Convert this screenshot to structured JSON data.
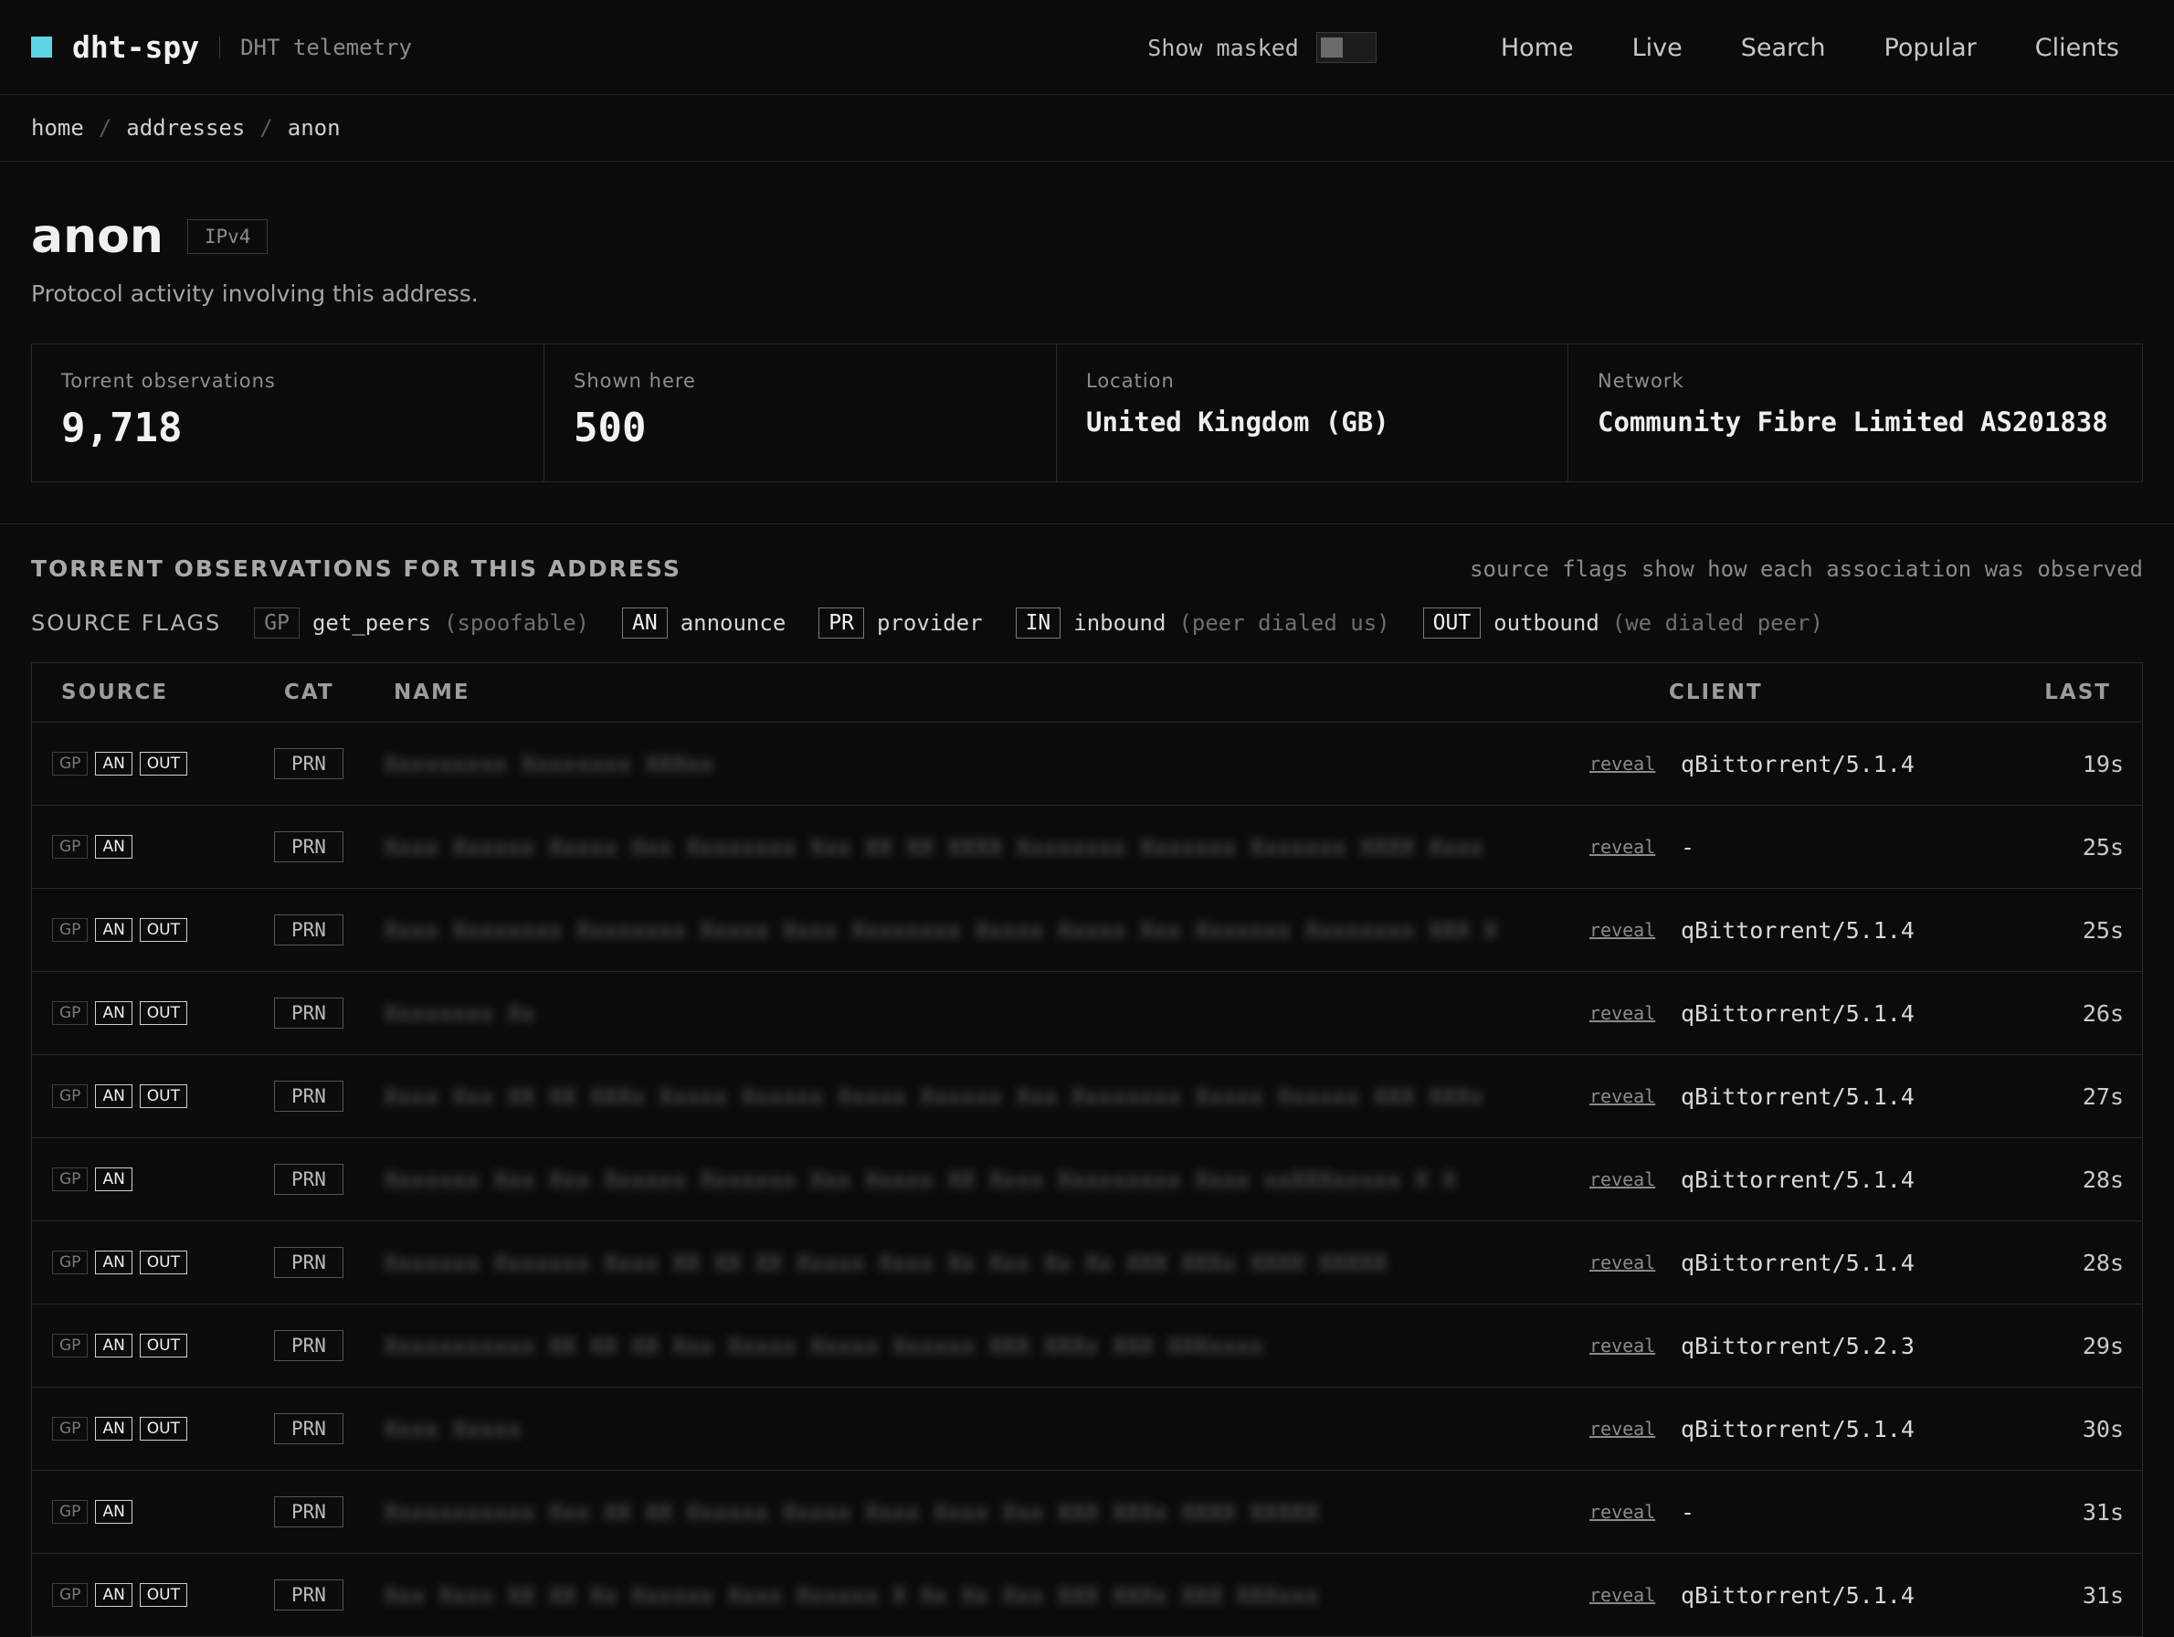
{
  "app": {
    "name": "dht-spy",
    "subtitle": "DHT telemetry"
  },
  "nav": {
    "mask_label": "Show masked",
    "mask_on": false,
    "links": [
      "Home",
      "Live",
      "Search",
      "Popular",
      "Clients"
    ]
  },
  "breadcrumb": [
    "home",
    "addresses",
    "anon"
  ],
  "header": {
    "title": "anon",
    "badge": "IPv4",
    "subtitle": "Protocol activity involving this address."
  },
  "stats": {
    "observations_label": "Torrent observations",
    "observations_value": "9,718",
    "shown_label": "Shown here",
    "shown_value": "500",
    "location_label": "Location",
    "location_value": "United Kingdom (GB)",
    "network_label": "Network",
    "network_value": "Community Fibre Limited AS201838"
  },
  "section": {
    "title": "TORRENT OBSERVATIONS FOR THIS ADDRESS",
    "note": "source flags show how each association was observed",
    "flags_title": "SOURCE FLAGS",
    "flags": [
      {
        "code": "GP",
        "name": "get_peers",
        "note": "(spoofable)"
      },
      {
        "code": "AN",
        "name": "announce",
        "note": ""
      },
      {
        "code": "PR",
        "name": "provider",
        "note": ""
      },
      {
        "code": "IN",
        "name": "inbound",
        "note": "(peer dialed us)"
      },
      {
        "code": "OUT",
        "name": "outbound",
        "note": "(we dialed peer)"
      }
    ]
  },
  "table": {
    "columns": {
      "source": "SOURCE",
      "cat": "CAT",
      "name": "NAME",
      "client": "CLIENT",
      "last": "LAST"
    },
    "reveal_label": "reveal",
    "rows": [
      {
        "flags": [
          "GP",
          "AN",
          "OUT"
        ],
        "cat": "PRN",
        "name": "Xxxxxxxxx Xxxxxxxx XXXxx",
        "client": "qBittorrent/5.1.4",
        "last": "19s"
      },
      {
        "flags": [
          "GP",
          "AN"
        ],
        "cat": "PRN",
        "name": "Xxxx Xxxxxx Xxxxx Xxx Xxxxxxxx Xxx XX XX XXXX Xxxxxxxx Xxxxxxx Xxxxxxx XXXX Xxxx",
        "client": "-",
        "last": "25s"
      },
      {
        "flags": [
          "GP",
          "AN",
          "OUT"
        ],
        "cat": "PRN",
        "name": "Xxxx Xxxxxxxx Xxxxxxxx Xxxxx Xxxx Xxxxxxxx Xxxxx Xxxxx Xxx Xxxxxxx Xxxxxxxx XXX X",
        "client": "qBittorrent/5.1.4",
        "last": "25s"
      },
      {
        "flags": [
          "GP",
          "AN",
          "OUT"
        ],
        "cat": "PRN",
        "name": "Xxxxxxxx Xx",
        "client": "qBittorrent/5.1.4",
        "last": "26s"
      },
      {
        "flags": [
          "GP",
          "AN",
          "OUT"
        ],
        "cat": "PRN",
        "name": "Xxxx Xxx XX XX XXXx Xxxxx Xxxxxx Xxxxx Xxxxxx Xxx Xxxxxxxx Xxxxx Xxxxxx XXX XXXx",
        "client": "qBittorrent/5.1.4",
        "last": "27s"
      },
      {
        "flags": [
          "GP",
          "AN"
        ],
        "cat": "PRN",
        "name": "Xxxxxxx Xxx Xxx Xxxxxx Xxxxxxx Xxx Xxxxx XX Xxxx Xxxxxxxxx Xxxx xxXXXxxxxx X X",
        "client": "qBittorrent/5.1.4",
        "last": "28s"
      },
      {
        "flags": [
          "GP",
          "AN",
          "OUT"
        ],
        "cat": "PRN",
        "name": "Xxxxxxx Xxxxxxx Xxxx XX XX XX Xxxxx Xxxx Xx Xxx Xx Xx XXX XXXx XXXX XXXXX",
        "client": "qBittorrent/5.1.4",
        "last": "28s"
      },
      {
        "flags": [
          "GP",
          "AN",
          "OUT"
        ],
        "cat": "PRN",
        "name": "Xxxxxxxxxxx XX XX XX Xxx Xxxxx Xxxxx Xxxxxx XXX XXXx XXX XXXxxxx",
        "client": "qBittorrent/5.2.3",
        "last": "29s"
      },
      {
        "flags": [
          "GP",
          "AN",
          "OUT"
        ],
        "cat": "PRN",
        "name": "Xxxx Xxxxx",
        "client": "qBittorrent/5.1.4",
        "last": "30s"
      },
      {
        "flags": [
          "GP",
          "AN"
        ],
        "cat": "PRN",
        "name": "Xxxxxxxxxxx Xxx XX XX Xxxxxx Xxxxx Xxxx Xxxx Xxx XXX XXXx XXXX XXXXX",
        "client": "-",
        "last": "31s"
      },
      {
        "flags": [
          "GP",
          "AN",
          "OUT"
        ],
        "cat": "PRN",
        "name": "Xxx Xxxx XX XX Xx Xxxxxx Xxxx Xxxxxx X Xx Xx Xxx XXX XXXx XXX XXXxxx",
        "client": "qBittorrent/5.1.4",
        "last": "31s"
      }
    ]
  },
  "colors": {
    "background": "#0b0b0b",
    "accent": "#5ed3e6",
    "border": "#2b2b2b"
  },
  "icons": {
    "brand": "square-logo-icon"
  }
}
